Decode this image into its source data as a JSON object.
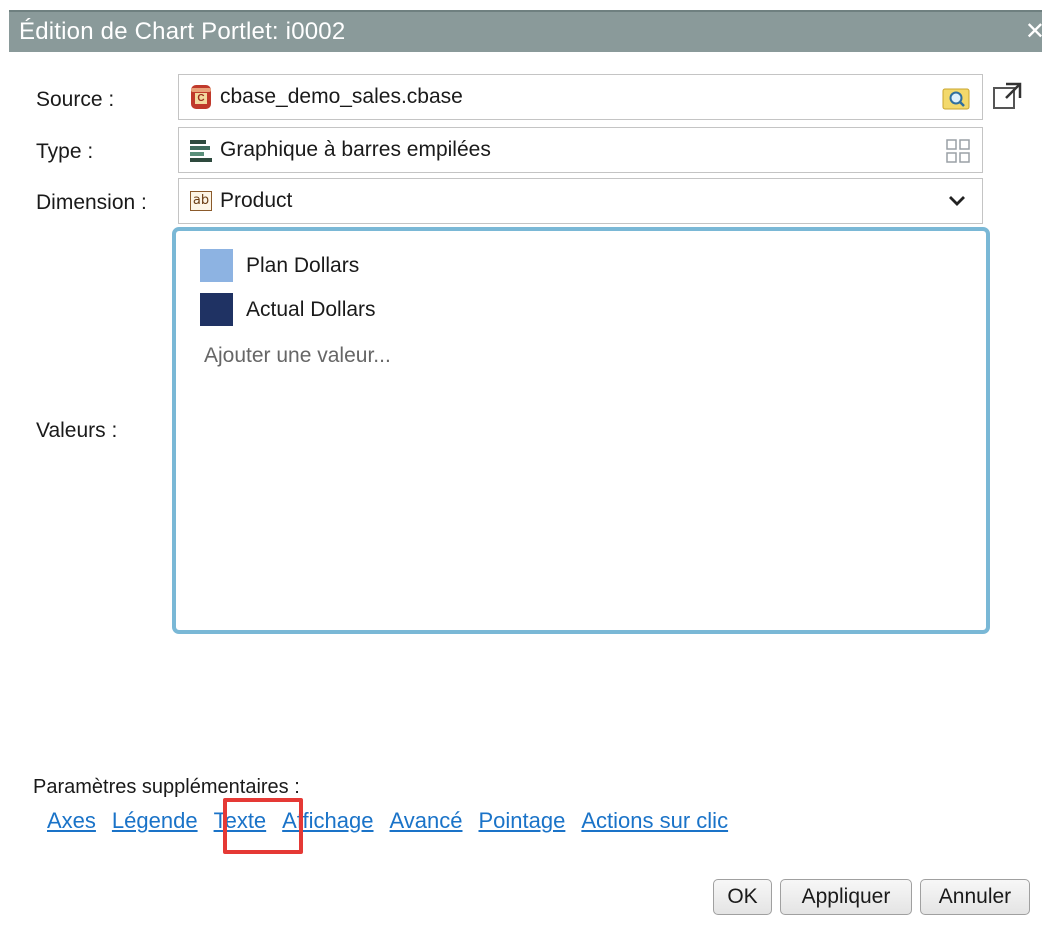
{
  "dialog": {
    "title": "Édition de Chart Portlet: i0002",
    "close_glyph": "✕"
  },
  "form": {
    "source": {
      "label": "Source :",
      "value": "cbase_demo_sales.cbase",
      "icon": "cbase-db-icon",
      "action_icon": "folder-search-icon",
      "external_icon": "open-external-icon"
    },
    "type": {
      "label": "Type :",
      "value": "Graphique à barres empilées",
      "icon": "stacked-bar-chart-icon",
      "action_icon": "grid-icon"
    },
    "dimension": {
      "label": "Dimension :",
      "value": "Product",
      "icon": "text-field-ab-icon",
      "action_icon": "chevron-down-icon"
    },
    "values": {
      "label": "Valeurs :",
      "items": [
        {
          "name": "Plan Dollars",
          "color": "#8db3e2"
        },
        {
          "name": "Actual Dollars",
          "color": "#1f3263"
        }
      ],
      "add_placeholder": "Ajouter une valeur..."
    }
  },
  "params": {
    "label": "Paramètres supplémentaires :",
    "links": [
      "Axes",
      "Légende",
      "Texte",
      "Affichage",
      "Avancé",
      "Pointage",
      "Actions sur clic"
    ],
    "highlighted": "Texte"
  },
  "buttons": {
    "ok": "OK",
    "apply": "Appliquer",
    "cancel": "Annuler"
  }
}
